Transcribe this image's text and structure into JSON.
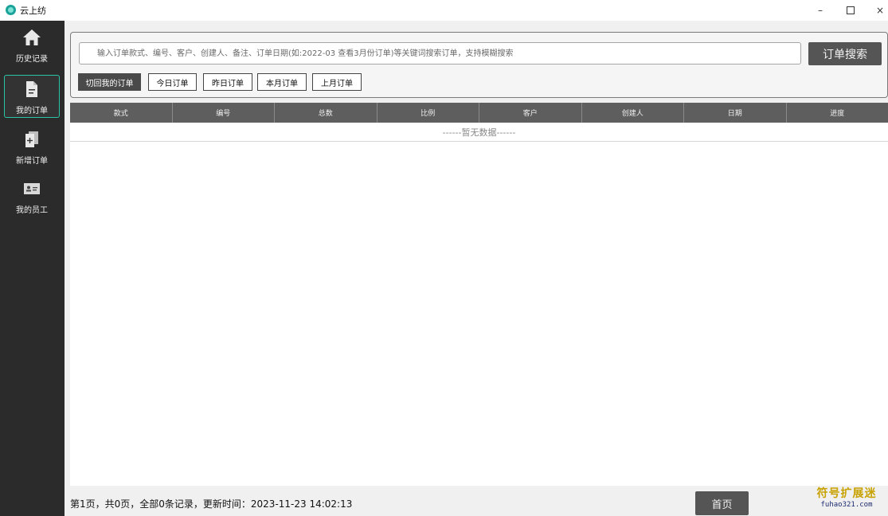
{
  "window": {
    "title": "云上纺",
    "controls": [
      "–",
      "×"
    ]
  },
  "sidebar": {
    "items": [
      {
        "label": "历史记录",
        "icon": "home-icon",
        "active": false
      },
      {
        "label": "我的订单",
        "icon": "document-icon",
        "active": true
      },
      {
        "label": "新增订单",
        "icon": "add-document-icon",
        "active": false
      },
      {
        "label": "我的员工",
        "icon": "id-card-icon",
        "active": false
      }
    ]
  },
  "search": {
    "placeholder": "输入订单款式、编号、客户、创建人、备注、订单日期(如:2022-03 查看3月份订单)等关键词搜索订单，支持模糊搜索",
    "button_label": "订单搜索"
  },
  "filters": [
    {
      "label": "切回我的订单",
      "active": true
    },
    {
      "label": "今日订单",
      "active": false
    },
    {
      "label": "昨日订单",
      "active": false
    },
    {
      "label": "本月订单",
      "active": false
    },
    {
      "label": "上月订单",
      "active": false
    }
  ],
  "table": {
    "columns": [
      "款式",
      "编号",
      "总数",
      "比例",
      "客户",
      "创建人",
      "日期",
      "进度"
    ],
    "empty_text": "------暂无数据------"
  },
  "footer": {
    "page_info": "第1页，共0页，全部0条记录，更新时间：2023-11-23 14:02:13",
    "home_button": "首页"
  },
  "watermark": {
    "cn": "符号扩展迷",
    "en": "fuhao321.com"
  },
  "colors": {
    "sidebar_bg": "#2b2b2b",
    "active_border": "#2bc4a8",
    "header_bg": "#5e5e5e",
    "button_bg": "#555555"
  }
}
